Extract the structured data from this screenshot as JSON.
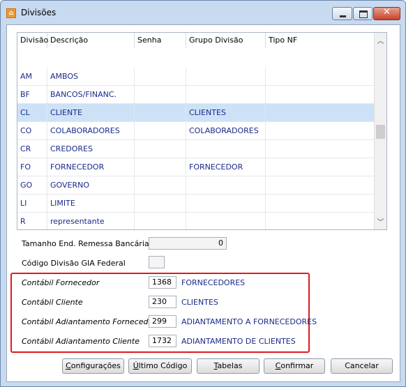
{
  "window": {
    "title": "Divisões",
    "app_icon": "app-logo-icon"
  },
  "grid": {
    "columns": [
      "Divisão",
      "Descrição",
      "Senha",
      "Grupo Divisão",
      "Tipo NF"
    ],
    "rows": [
      {
        "divisao": "AM",
        "descricao": "AMBOS",
        "senha": "",
        "grupo": "",
        "tipo": ""
      },
      {
        "divisao": "BF",
        "descricao": "BANCOS/FINANC.",
        "senha": "",
        "grupo": "",
        "tipo": ""
      },
      {
        "divisao": "CL",
        "descricao": "CLIENTE",
        "senha": "",
        "grupo": "CLIENTES",
        "tipo": ""
      },
      {
        "divisao": "CO",
        "descricao": "COLABORADORES",
        "senha": "",
        "grupo": "COLABORADORES",
        "tipo": ""
      },
      {
        "divisao": "CR",
        "descricao": "CREDORES",
        "senha": "",
        "grupo": "",
        "tipo": ""
      },
      {
        "divisao": "FO",
        "descricao": "FORNECEDOR",
        "senha": "",
        "grupo": "FORNECEDOR",
        "tipo": ""
      },
      {
        "divisao": "GO",
        "descricao": "GOVERNO",
        "senha": "",
        "grupo": "",
        "tipo": ""
      },
      {
        "divisao": "LI",
        "descricao": "LIMITE",
        "senha": "",
        "grupo": "",
        "tipo": ""
      },
      {
        "divisao": "R",
        "descricao": "representante",
        "senha": "",
        "grupo": "",
        "tipo": ""
      }
    ],
    "selected_row": 2
  },
  "form": {
    "tamanho_label": "Tamanho End. Remessa Bancária",
    "tamanho_value": "0",
    "gia_label": "Código Divisão GIA Federal",
    "gia_value": "",
    "contabil": [
      {
        "label": "Contábil Fornecedor",
        "code": "1368",
        "account": "FORNECEDORES"
      },
      {
        "label": "Contábil Cliente",
        "code": "230",
        "account": "CLIENTES"
      },
      {
        "label": "Contábil Adiantamento Fornecedor",
        "code": "299",
        "account": "ADIANTAMENTO A FORNECEDORES"
      },
      {
        "label": "Contábil Adiantamento Cliente",
        "code": "1732",
        "account": "ADIANTAMENTO DE CLIENTES"
      }
    ]
  },
  "buttons": {
    "configuracoes": {
      "u": "C",
      "rest": "onfigurações"
    },
    "ultimo_codigo": {
      "u": "Ú",
      "rest": "ltimo Código"
    },
    "tabelas": {
      "u": "T",
      "rest": "abelas"
    },
    "confirmar": {
      "u": "C",
      "rest": "onfirmar"
    },
    "cancelar": {
      "u": "",
      "rest": "Cancelar"
    }
  },
  "highlight_color": "#e01b1b",
  "accent_text_color": "#1a2a8a"
}
